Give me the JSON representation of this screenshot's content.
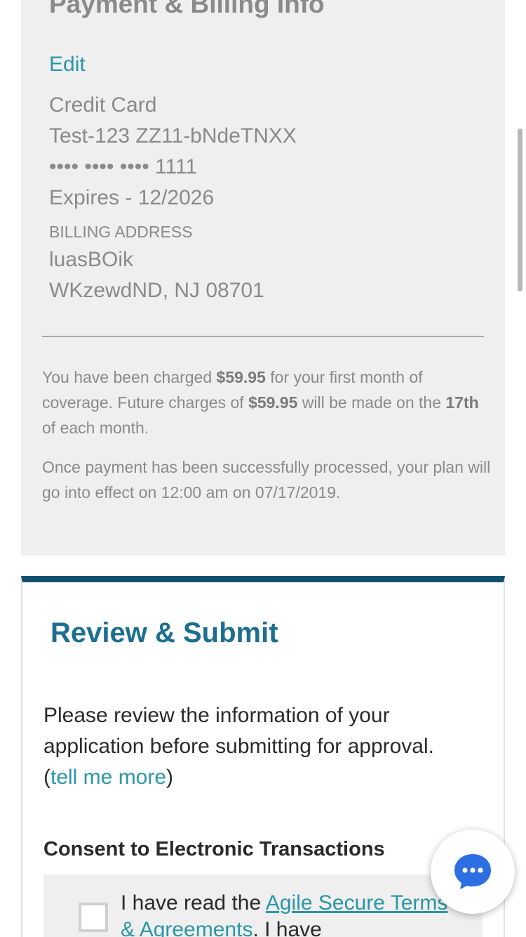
{
  "billing": {
    "title": "Payment & Billing Info",
    "edit_label": "Edit",
    "payment_method": "Credit Card",
    "card_name": "Test-123 ZZ11-bNdeTNXX",
    "card_number_masked": "•••• •••• •••• 1111",
    "expires": "Expires - 12/2026",
    "billing_address_label": "BILLING ADDRESS",
    "address_line1": "luasBOik",
    "address_line2": "WKzewdND, NJ 08701",
    "charge_intro": "You have been charged ",
    "first_charge": "$59.95",
    "charge_mid": " for your first month of coverage. Future charges of ",
    "future_charge": "$59.95",
    "charge_mid2": " will be made on the ",
    "charge_day": "17th",
    "charge_end": " of each month.",
    "effect_text": "Once payment has been successfully processed, your plan will go into effect on 12:00 am on 07/17/2019."
  },
  "review": {
    "title": "Review & Submit",
    "intro_text": "Please review the information of your application before submitting for approval.",
    "open_paren": "(",
    "tell_more_link": "tell me more",
    "close_paren": ")",
    "consent_heading": "Consent to Electronic Transactions",
    "consent_prefix": "I have read the ",
    "consent_link": "Agile Secure Terms & Agreements",
    "consent_suffix": ". I have"
  },
  "colors": {
    "accent_teal": "#2b96a5",
    "header_blue": "#1d6f8f",
    "card_top_bar": "#13506e",
    "chat_icon": "#2d6fe3"
  },
  "icons": {
    "chat": "chat-bubble-icon",
    "checkbox": "checkbox-unchecked"
  }
}
